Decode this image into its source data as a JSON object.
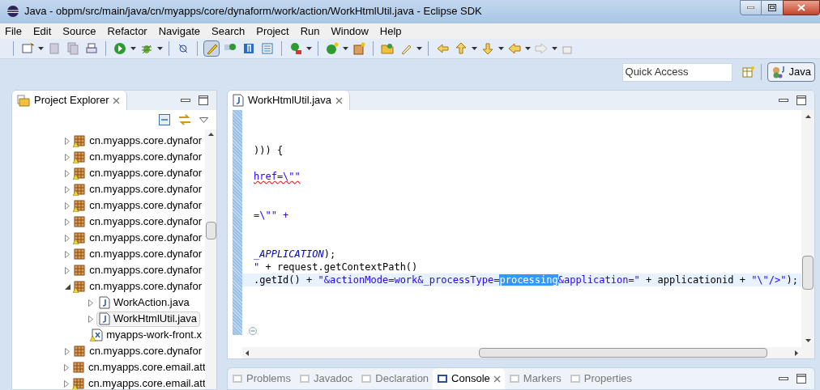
{
  "window": {
    "title": "Java - obpm/src/main/java/cn/myapps/core/dynaform/work/action/WorkHtmlUtil.java - Eclipse SDK"
  },
  "menu": [
    "File",
    "Edit",
    "Source",
    "Refactor",
    "Navigate",
    "Search",
    "Project",
    "Run",
    "Window",
    "Help"
  ],
  "toolbar": {
    "highlight_toggle": {
      "selected": true
    }
  },
  "quick_access": {
    "placeholder": "Quick Access"
  },
  "perspective": {
    "label": "Java",
    "selected": true
  },
  "project_explorer": {
    "title": "Project Explorer",
    "items": [
      {
        "label": "cn.myapps.core.dynafor",
        "kind": "package",
        "warning": true,
        "expanded": false,
        "selected": false
      },
      {
        "label": "cn.myapps.core.dynafor",
        "kind": "package",
        "warning": true,
        "expanded": false,
        "selected": false
      },
      {
        "label": "cn.myapps.core.dynafor",
        "kind": "package",
        "warning": true,
        "expanded": false,
        "selected": false
      },
      {
        "label": "cn.myapps.core.dynafor",
        "kind": "package",
        "warning": true,
        "expanded": false,
        "selected": false
      },
      {
        "label": "cn.myapps.core.dynafor",
        "kind": "package",
        "warning": true,
        "expanded": false,
        "selected": false
      },
      {
        "label": "cn.myapps.core.dynafor",
        "kind": "package",
        "warning": false,
        "expanded": false,
        "selected": false
      },
      {
        "label": "cn.myapps.core.dynafor",
        "kind": "package",
        "warning": true,
        "expanded": false,
        "selected": false
      },
      {
        "label": "cn.myapps.core.dynafor",
        "kind": "package",
        "warning": false,
        "expanded": false,
        "selected": false
      },
      {
        "label": "cn.myapps.core.dynafor",
        "kind": "package",
        "warning": false,
        "expanded": false,
        "selected": false
      },
      {
        "label": "cn.myapps.core.dynafor",
        "kind": "package",
        "warning": true,
        "expanded": true,
        "selected": false,
        "children": [
          {
            "label": "WorkAction.java",
            "kind": "java",
            "warning": false,
            "selected": false
          },
          {
            "label": "WorkHtmlUtil.java",
            "kind": "java",
            "warning": false,
            "selected": true
          },
          {
            "label": "myapps-work-front.x",
            "kind": "xml",
            "warning": true,
            "selected": false
          }
        ]
      },
      {
        "label": "cn.myapps.core.dynafor",
        "kind": "package",
        "warning": false,
        "expanded": false,
        "selected": false
      },
      {
        "label": "cn.myapps.core.email.att",
        "kind": "package",
        "warning": false,
        "expanded": false,
        "selected": false
      },
      {
        "label": "cn.myapps.core.email.att",
        "kind": "package",
        "warning": true,
        "expanded": false,
        "selected": false
      }
    ]
  },
  "editor": {
    "tab": "WorkHtmlUtil.java",
    "lines": [
      {
        "kind": "blank"
      },
      {
        "kind": "blank"
      },
      {
        "kind": "code",
        "segments": [
          {
            "text": "))) {",
            "kind": "plain"
          }
        ]
      },
      {
        "kind": "blank"
      },
      {
        "kind": "code",
        "segments": [
          {
            "text": "href=\\\"\"",
            "kind": "string",
            "error": true
          }
        ]
      },
      {
        "kind": "blank"
      },
      {
        "kind": "blank"
      },
      {
        "kind": "code",
        "segments": [
          {
            "text": "=\\\"\" +",
            "kind": "string",
            "error": false
          }
        ]
      },
      {
        "kind": "blank"
      },
      {
        "kind": "blank"
      },
      {
        "kind": "code",
        "segments": [
          {
            "text": "_APPLICATION",
            "kind": "constant"
          },
          {
            "text": ");",
            "kind": "plain"
          }
        ]
      },
      {
        "kind": "code",
        "segments": [
          {
            "text": "\"",
            "kind": "string",
            "error": false
          },
          {
            "text": " + request.getContextPath()",
            "kind": "plain"
          }
        ]
      },
      {
        "kind": "current",
        "segments": [
          {
            "text": ".getId() + ",
            "kind": "plain"
          },
          {
            "text": "\"&actionMode=work&_processType=",
            "kind": "string",
            "error": false
          },
          {
            "text": "processing",
            "kind": "selection"
          },
          {
            "text": "&application=\"",
            "kind": "string",
            "error": false
          },
          {
            "text": " + applicationid + ",
            "kind": "plain"
          },
          {
            "text": "\"\\\"/>\"",
            "kind": "string",
            "error": false
          },
          {
            "text": ");",
            "kind": "plain"
          }
        ]
      }
    ]
  },
  "bottom_tabs": [
    {
      "label": "Problems",
      "selected": false
    },
    {
      "label": "Javadoc",
      "selected": false
    },
    {
      "label": "Declaration",
      "selected": false
    },
    {
      "label": "Console",
      "selected": true
    },
    {
      "label": "Markers",
      "selected": false
    },
    {
      "label": "Properties",
      "selected": false
    }
  ]
}
